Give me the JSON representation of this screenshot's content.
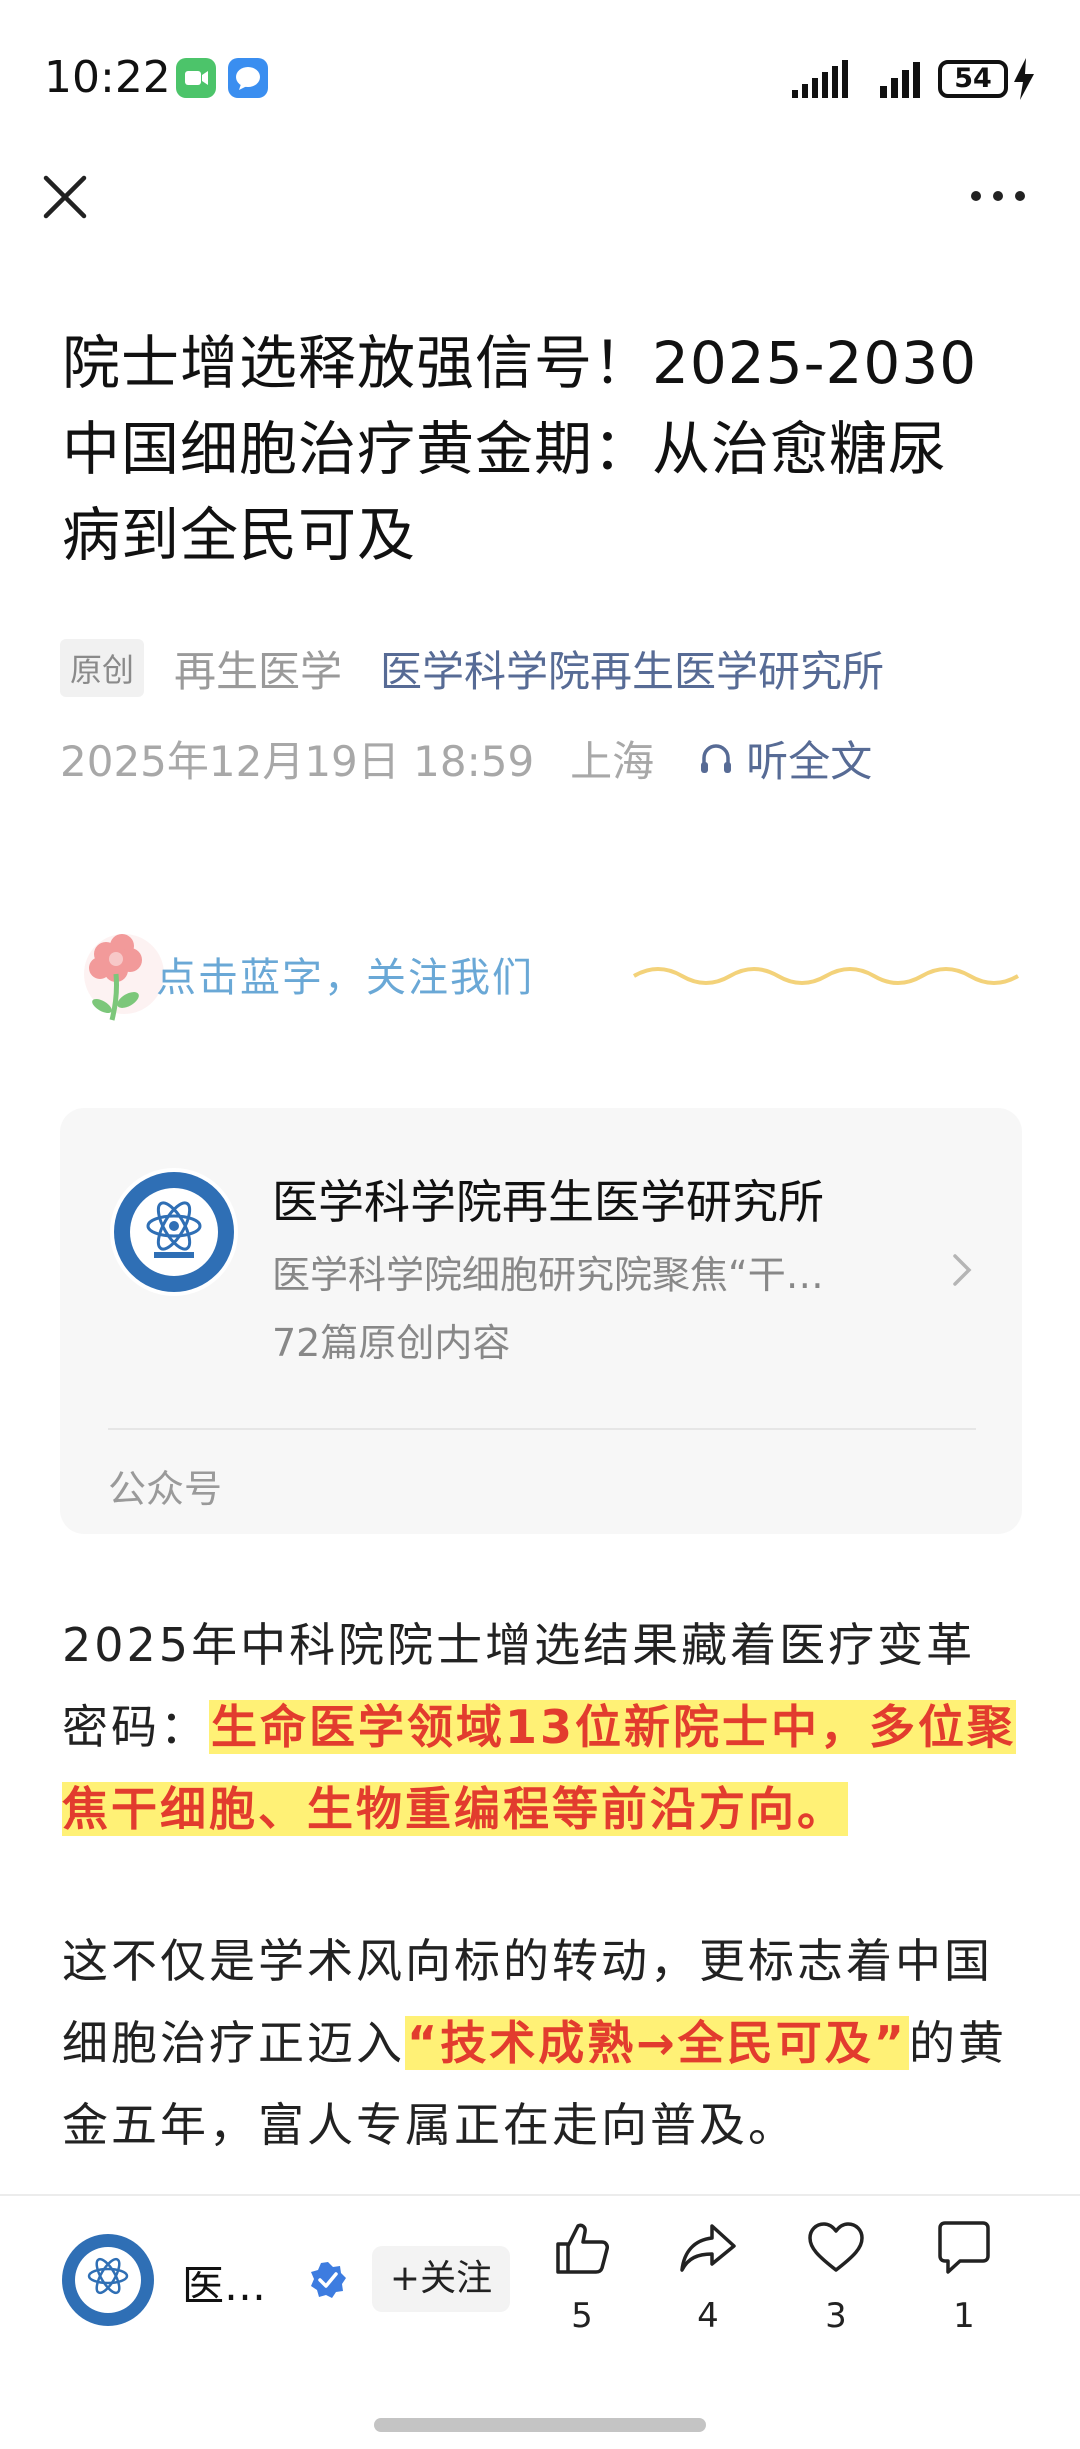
{
  "status_bar": {
    "time": "10:22",
    "battery": "54"
  },
  "article": {
    "title": "院士增选释放强信号！2025-2030 中国细胞治疗黄金期：从治愈糖尿病到全民可及",
    "badge": "原创",
    "source": "再生医学",
    "account": "医学科学院再生医学研究所",
    "date": "2025年12月19日 18:59",
    "location": "上海",
    "listen_label": "听全文",
    "follow_tip": "点击蓝字，关注我们"
  },
  "account_card": {
    "name": "医学科学院再生医学研究所",
    "description": "医学科学院细胞研究院聚焦“干…",
    "original_count": "72篇原创内容",
    "footer_label": "公众号"
  },
  "paragraphs": {
    "p1_prefix": "2025年中科院院士增选结果藏着医疗变革密码：",
    "p1_highlight": "生命医学领域13位新院士中，多位聚焦干细胞、生物重编程等前沿方向。",
    "p2_prefix": "这不仅是学术风向标的转动，更标志着中国细胞治疗正迈入",
    "p2_highlight": "“技术成熟→全民可及”",
    "p2_suffix": "的黄金五年，富人专属正在走向普及。"
  },
  "bottom_bar": {
    "author_name": "医…",
    "follow_label": "+关注",
    "likes": "5",
    "shares": "4",
    "favorites": "3",
    "comments": "1"
  },
  "colors": {
    "link": "#576b95",
    "highlight_bg": "#fff176",
    "highlight_text": "#e23c2e",
    "verify": "#3d7ce0"
  }
}
